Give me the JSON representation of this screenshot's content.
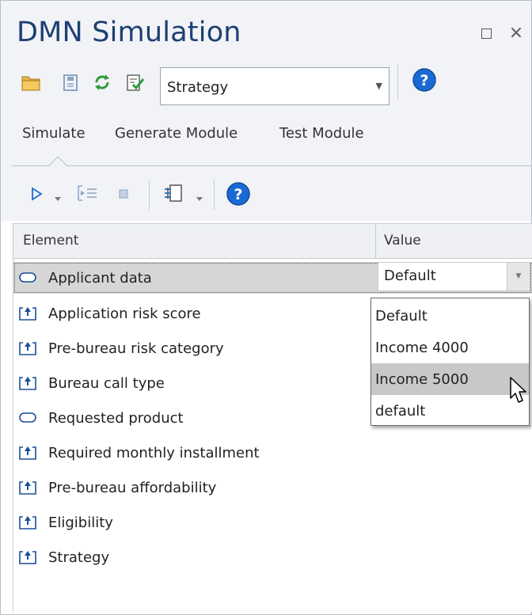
{
  "window": {
    "title": "DMN Simulation",
    "close_glyph": "×"
  },
  "toolbar": {
    "icons": [
      "folder-open-icon",
      "save-icon",
      "refresh-icon",
      "validate-icon",
      "help-icon"
    ],
    "strategy_select": {
      "value": "Strategy"
    }
  },
  "tabs": [
    {
      "label": "Simulate",
      "selected": true
    },
    {
      "label": "Generate Module"
    },
    {
      "label": "Test Module"
    }
  ],
  "sim_toolbar": {
    "icons": [
      "run-icon",
      "dropdown-icon",
      "step-icon",
      "stop-icon",
      "module-icon",
      "dropdown-icon",
      "help-icon"
    ]
  },
  "grid": {
    "columns": [
      "Element",
      "Value"
    ],
    "rows": [
      {
        "label": "Applicant data",
        "icon": "input-data-icon",
        "value": "Default",
        "selected": true
      },
      {
        "label": "Application risk score",
        "icon": "decision-icon"
      },
      {
        "label": "Pre-bureau risk category",
        "icon": "decision-icon"
      },
      {
        "label": "Bureau call type",
        "icon": "decision-icon"
      },
      {
        "label": "Requested product",
        "icon": "input-data-icon"
      },
      {
        "label": "Required monthly installment",
        "icon": "decision-icon"
      },
      {
        "label": "Pre-bureau affordability",
        "icon": "decision-icon"
      },
      {
        "label": "Eligibility",
        "icon": "decision-icon"
      },
      {
        "label": "Strategy",
        "icon": "decision-icon"
      }
    ]
  },
  "value_dropdown": {
    "options": [
      "Default",
      "Income 4000",
      "Income 5000",
      "default"
    ],
    "highlighted": "Income 5000"
  },
  "colors": {
    "title": "#1e3f72",
    "chrome": "#f1f3f7",
    "selected_row": "#d6d6d6",
    "accent_blue": "#1b6ad3"
  }
}
